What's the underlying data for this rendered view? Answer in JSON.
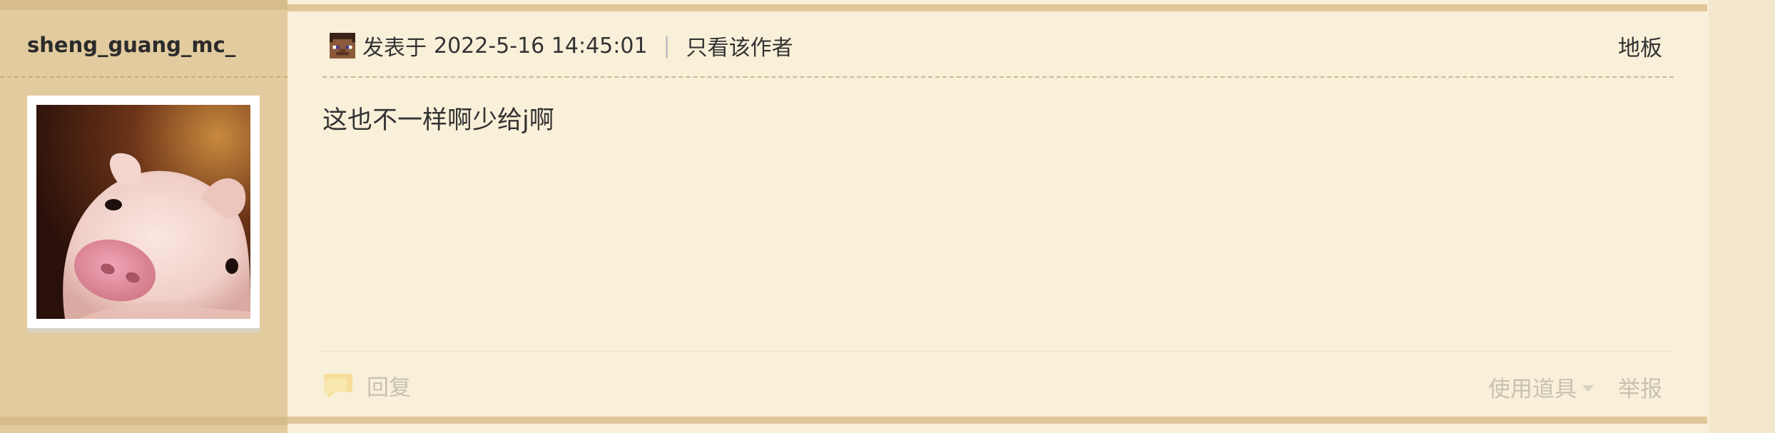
{
  "author": {
    "username": "sheng_guang_mc_",
    "avatar_icon": "pig-photo"
  },
  "post": {
    "posted_prefix": "发表于",
    "posted_time": "2022-5-16 14:45:01",
    "separator": "|",
    "only_author_label": "只看该作者",
    "floor_label": "地板",
    "content": "这也不一样啊少给j啊"
  },
  "actions": {
    "reply_label": "回复",
    "tools_label": "使用道具",
    "report_label": "举报"
  },
  "colors": {
    "sidebar_bg": "#e2cb9e",
    "main_bg": "#f9f0d9",
    "band": "#e0c79a",
    "muted_text": "#c8c1b1"
  }
}
